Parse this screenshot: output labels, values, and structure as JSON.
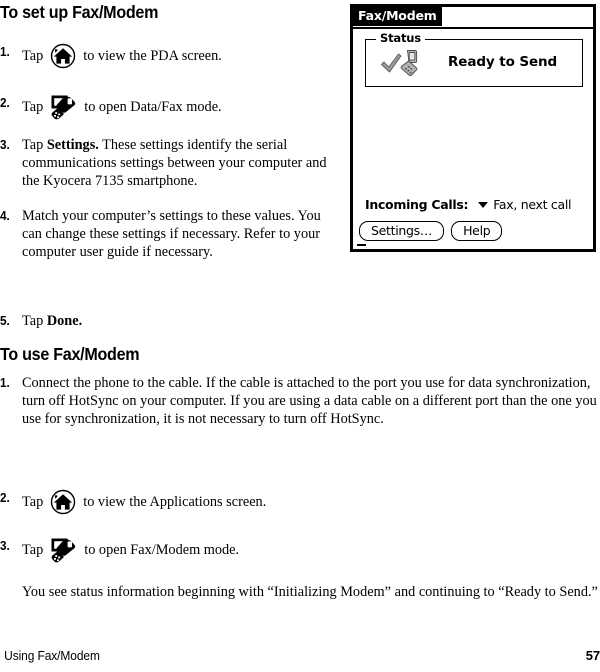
{
  "page": {
    "footer_section": "Using Fax/Modem",
    "page_number": "57"
  },
  "section_setup": {
    "heading": "To set up Fax/Modem",
    "steps": [
      {
        "num": "1.",
        "pre": "Tap",
        "icon": "home-icon",
        "post": "to view the PDA screen."
      },
      {
        "num": "2.",
        "pre": "Tap",
        "icon": "data-fax-icon",
        "post": "to open Data/Fax mode."
      },
      {
        "num": "3.",
        "lead": "Tap ",
        "bold": "Settings.",
        "text": " These settings identify the serial communications settings between your computer and the Kyocera 7135 smartphone."
      },
      {
        "num": "4.",
        "text": "Match your computer’s settings to these values. You can change these settings if necessary. Refer to your computer user guide if necessary."
      },
      {
        "num": "5.",
        "lead": "Tap ",
        "bold": "Done."
      }
    ]
  },
  "section_use": {
    "heading": "To use Fax/Modem",
    "steps": [
      {
        "num": "1.",
        "text": "Connect the phone to the cable. If the cable is attached to the port you use for data synchronization, turn off HotSync on your computer. If you are using a data cable on a different port than the one you use for synchronization, it is not necessary to turn off HotSync."
      },
      {
        "num": "2.",
        "pre": "Tap",
        "icon": "home-icon",
        "post": "to view the Applications screen."
      },
      {
        "num": "3.",
        "pre": "Tap",
        "icon": "data-fax-icon",
        "post": "to open Fax/Modem mode."
      }
    ],
    "note": "You see status information beginning with “Initializing Modem” and continuing to “Ready to Send.”"
  },
  "pda_screen": {
    "title": "Fax/Modem",
    "status_group_label": "Status",
    "status_text": "Ready to Send",
    "status_icon": "check-and-phone-icon",
    "incoming_label": "Incoming Calls:",
    "incoming_value": "Fax, next call",
    "dropdown_icon": "chevron-down-icon",
    "buttons": [
      {
        "label": "Settings…"
      },
      {
        "label": "Help"
      }
    ]
  },
  "colors": {
    "ink": "#000000",
    "paper": "#ffffff",
    "icon_gray": "#9a9a9a"
  }
}
